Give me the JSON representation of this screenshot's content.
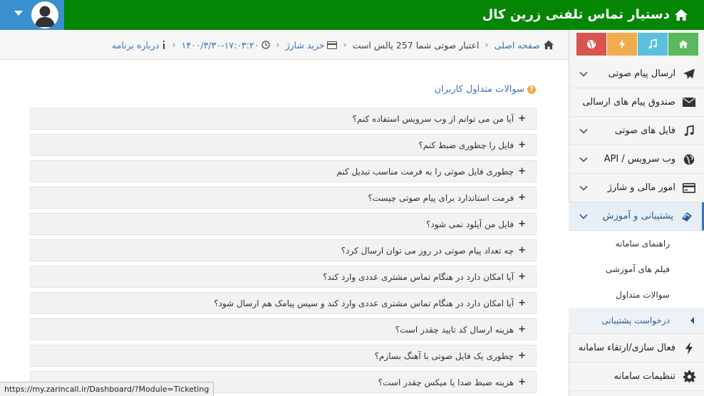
{
  "header": {
    "title": "دستیار تماس تلفنی زرین کال",
    "colors": {
      "header_bg": "#058605",
      "user_box": "#3a8fcf"
    }
  },
  "breadcrumb": {
    "home": "صفحه اصلی",
    "balance": "اعتبار صوتی شما 257 پالس است",
    "buy_charge": "خرید شارژ",
    "datetime": "۱۴۰۰/۳/۳۰-۱۷:۰۳:۲۰",
    "about": "درباره برنامه"
  },
  "shortcuts": [
    {
      "icon": "home-icon",
      "color": "#5cb85c"
    },
    {
      "icon": "music-icon",
      "color": "#5bc0de"
    },
    {
      "icon": "bolt-icon",
      "color": "#f0ad4e"
    },
    {
      "icon": "globe-icon",
      "color": "#d9534f"
    }
  ],
  "sidebar": {
    "items": [
      {
        "label": "ارسال پیام صوتی",
        "icon": "paper-plane-icon"
      },
      {
        "label": "صندوق پیام های ارسالی",
        "icon": "envelope-icon"
      },
      {
        "label": "فایل های صوتی",
        "icon": "music-icon"
      },
      {
        "label": "وب سرویس / API",
        "icon": "globe-icon"
      },
      {
        "label": "امور مالی و شارژ",
        "icon": "credit-card-icon"
      },
      {
        "label": "پشتیبانی و آموزش",
        "icon": "support-icon"
      }
    ],
    "subitems": [
      {
        "label": "راهنمای سامانه"
      },
      {
        "label": "فیلم های آموزشی"
      },
      {
        "label": "سوالات متداول"
      },
      {
        "label": "درخواست پشتیبانی"
      }
    ],
    "bottom_items": [
      {
        "label": "فعال سازی/ارتقاء سامانه",
        "icon": "bolt-icon"
      },
      {
        "label": "تنظیمات سامانه",
        "icon": "gear-icon"
      }
    ]
  },
  "faq": {
    "title": "سوالات متداول کاربران",
    "questions": [
      "آیا من می توانم از وب سرویس استفاده کنم؟",
      "فایل را چطوری ضبط کنم؟",
      "چطوری فایل صوتی را به فرمت مناسب تبدیل کنم",
      "فرمت استاندارد برای پیام صوتی چیست؟",
      "فایل من آپلود نمی شود؟",
      "چه تعداد پیام صوتی در روز می توان ارسال کرد؟",
      "آیا امکان دارد در هنگام تماس مشتری عددی وارد کند؟",
      "آیا امکان دارد در هنگام تماس مشتری عددی وارد کند و سپس پیامک هم ارسال شود؟",
      "هزینه ارسال کد تایید چقدر است؟",
      "چطوری یک فایل صوتی با آهنگ بسازم؟",
      "هزینه ضبط صدا یا میکس چقدر است؟"
    ]
  },
  "status_url": "https://my.zarincall.ir/Dashboard/?Module=Ticketing"
}
